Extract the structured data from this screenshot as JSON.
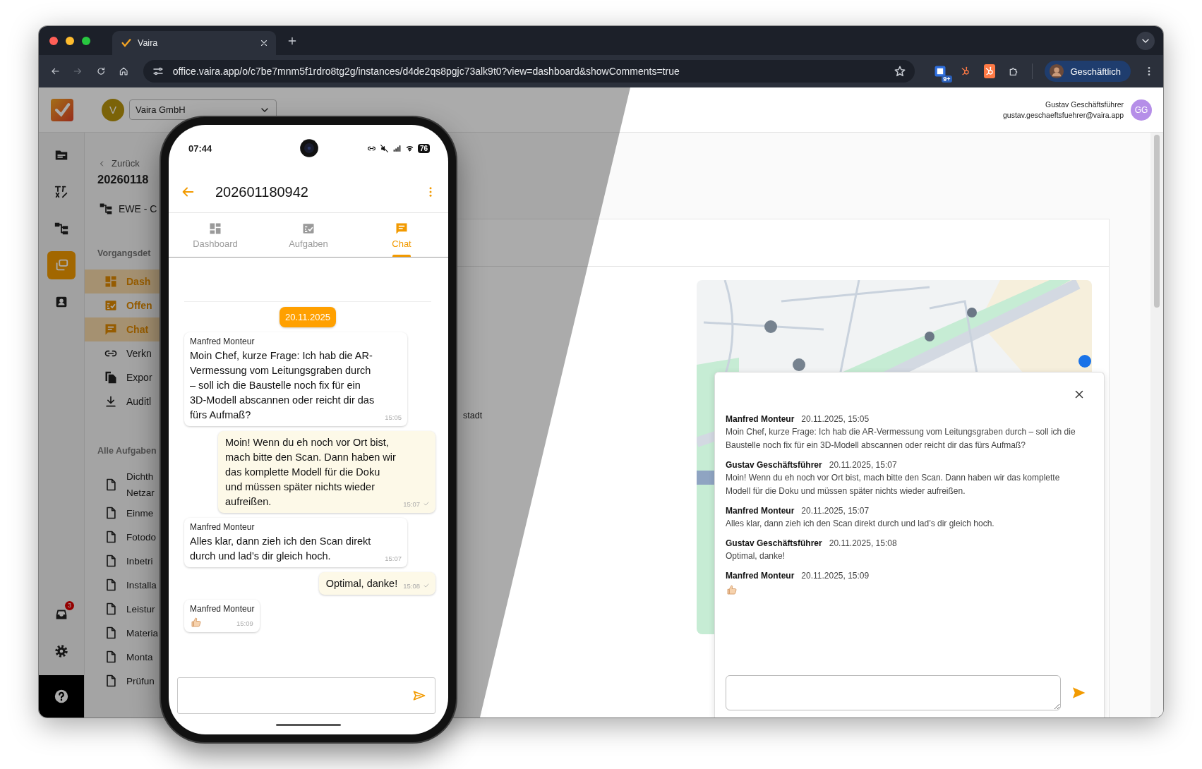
{
  "browser": {
    "tab_title": "Vaira",
    "url": "office.vaira.app/o/c7be7mnm5f1rdro8tg2g/instances/d4de2qs8pgjc73alk9t0?view=dashboard&showComments=true",
    "extension_badge": "9+",
    "profile": "Geschäftlich"
  },
  "header": {
    "org_initial": "V",
    "org_name": "Vaira GmbH",
    "user_name": "Gustav Geschäftsführer",
    "user_email": "gustav.geschaeftsfuehrer@vaira.app",
    "user_initials": "GG"
  },
  "rail": {
    "items": [
      {
        "selected": false
      },
      {
        "selected": false
      },
      {
        "selected": false
      },
      {
        "selected": true
      },
      {
        "selected": false
      }
    ],
    "inbox_badge": "3"
  },
  "sidebar": {
    "back": "Zurück",
    "title": "20260118",
    "project": "EWE - C",
    "section": "Vorgangsdet",
    "items": [
      {
        "label": "Dash",
        "accent": true,
        "selected": true
      },
      {
        "label": "Offen",
        "accent": true,
        "selected": false
      },
      {
        "label": "Chat",
        "accent": true,
        "selected": true
      },
      {
        "label": "Verkn",
        "accent": false,
        "selected": false
      },
      {
        "label": "Expor",
        "accent": false,
        "selected": false
      },
      {
        "label": "Auditl",
        "accent": false,
        "selected": false
      }
    ],
    "tasks_heading": "Alle Aufgaben",
    "tasks": [
      {
        "lines": [
          "Dichth",
          "Netzar"
        ]
      },
      {
        "lines": [
          "Einme"
        ]
      },
      {
        "lines": [
          "Fotodo"
        ]
      },
      {
        "lines": [
          "Inbetri"
        ]
      },
      {
        "lines": [
          "Installa"
        ]
      },
      {
        "lines": [
          "Leistur"
        ]
      },
      {
        "lines": [
          "Materia"
        ]
      },
      {
        "lines": [
          "Monta"
        ]
      },
      {
        "lines": [
          "Prüfun"
        ]
      }
    ]
  },
  "content": {
    "snippet": "stadt"
  },
  "comments": {
    "messages": [
      {
        "kind": "text",
        "author": "Manfred Monteur",
        "time": "20.11.2025, 15:05",
        "text": "Moin Chef, kurze Frage: Ich hab die AR-Vermessung vom Leitungsgraben durch – soll ich die Baustelle noch fix für ein 3D-Modell abscannen oder reicht dir das fürs Aufmaß?"
      },
      {
        "kind": "text",
        "author": "Gustav Geschäftsführer",
        "time": "20.11.2025, 15:07",
        "text": "Moin! Wenn du eh noch vor Ort bist, mach bitte den Scan. Dann haben wir das komplette Modell für die Doku und müssen später nichts wieder aufreißen."
      },
      {
        "kind": "text",
        "author": "Manfred Monteur",
        "time": "20.11.2025, 15:07",
        "text": "Alles klar, dann zieh ich den Scan direkt durch und lad’s dir gleich hoch."
      },
      {
        "kind": "text",
        "author": "Gustav Geschäftsführer",
        "time": "20.11.2025, 15:08",
        "text": "Optimal, danke!"
      },
      {
        "kind": "thumbs_up",
        "author": "Manfred Monteur",
        "time": "20.11.2025, 15:09"
      }
    ]
  },
  "phone": {
    "time": "07:44",
    "battery": "76",
    "title": "202601180942",
    "tabs": [
      {
        "label": "Dashboard",
        "selected": false
      },
      {
        "label": "Aufgaben",
        "selected": false
      },
      {
        "label": "Chat",
        "selected": true
      }
    ],
    "date": "20.11.2025",
    "messages": [
      {
        "kind": "incoming",
        "author": "Manfred Monteur",
        "text": "Moin Chef, kurze Frage: Ich hab die AR-Vermessung vom Leitungsgraben durch – soll ich die Baustelle noch fix für ein 3D-Modell abscannen oder reicht dir das fürs Aufmaß?",
        "time": "15:05"
      },
      {
        "kind": "outgoing",
        "text": "Moin! Wenn du eh noch vor Ort bist, mach bitte den Scan. Dann haben wir das komplette Modell für die Doku und müssen später nichts wieder aufreißen.",
        "time": "15:07"
      },
      {
        "kind": "incoming",
        "author": "Manfred Monteur",
        "text": "Alles klar, dann zieh ich den Scan direkt durch und lad’s dir gleich hoch.",
        "time": "15:07"
      },
      {
        "kind": "outgoing",
        "text": "Optimal, danke!",
        "time": "15:08"
      },
      {
        "kind": "incoming_thumbs_up",
        "author": "Manfred Monteur",
        "time": "15:09"
      }
    ]
  }
}
